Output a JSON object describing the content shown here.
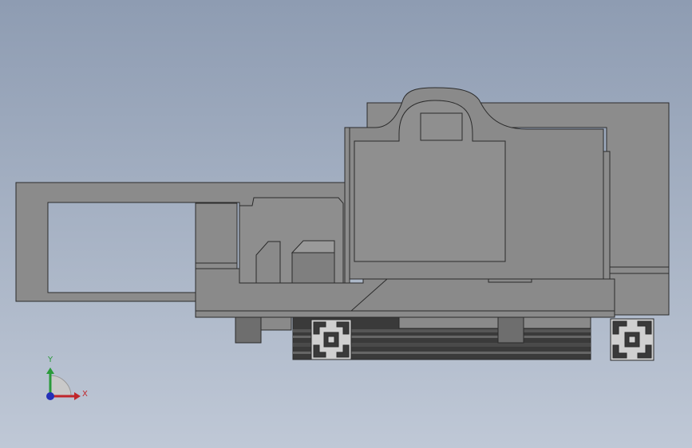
{
  "viewport": {
    "background_top": "#8e9cb2",
    "background_bottom": "#bfc8d6"
  },
  "model": {
    "body_color": "#8a8a8a",
    "body_light": "#9a9a9a",
    "body_dark": "#777777",
    "edge_color": "#2b2b2b",
    "profile_color": "#3a3a3a",
    "profile_highlight": "#c8c8c8"
  },
  "triad": {
    "x_label": "X",
    "y_label": "Y",
    "x_color": "#c0262b",
    "y_color": "#2a9a3a",
    "z_color": "#2330b8"
  }
}
